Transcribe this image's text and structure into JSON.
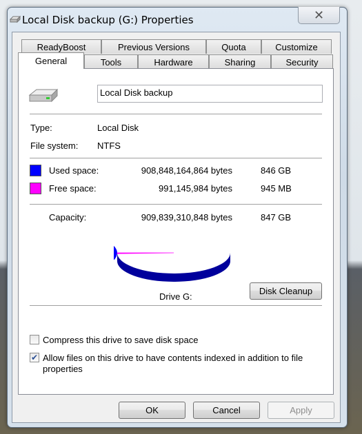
{
  "window": {
    "title": "Local Disk backup  (G:) Properties",
    "icon": "drive-icon",
    "close_icon": "close-icon"
  },
  "tabs_row1": [
    {
      "label": "ReadyBoost"
    },
    {
      "label": "Previous Versions"
    },
    {
      "label": "Quota"
    },
    {
      "label": "Customize"
    }
  ],
  "tabs_row2": [
    {
      "label": "General",
      "selected": true
    },
    {
      "label": "Tools"
    },
    {
      "label": "Hardware"
    },
    {
      "label": "Sharing"
    },
    {
      "label": "Security"
    }
  ],
  "general": {
    "drive_name": "Local Disk backup",
    "type_label": "Type:",
    "type_value": "Local Disk",
    "fs_label": "File system:",
    "fs_value": "NTFS",
    "used_label": "Used space:",
    "used_bytes": "908,848,164,864 bytes",
    "used_size": "846 GB",
    "free_label": "Free space:",
    "free_bytes": "991,145,984 bytes",
    "free_size": "945 MB",
    "capacity_label": "Capacity:",
    "capacity_bytes": "909,839,310,848 bytes",
    "capacity_size": "847 GB",
    "drive_label": "Drive G:",
    "disk_cleanup": "Disk Cleanup",
    "compress_label": "Compress this drive to save disk space",
    "compress_checked": false,
    "index_label_1": "Allow files on this drive to have contents indexed in addition to file",
    "index_label_2": "properties",
    "index_checked": true
  },
  "colors": {
    "used": "#0000ff",
    "used_side": "#00009c",
    "free": "#ff00ff"
  },
  "chart_data": {
    "type": "pie",
    "values": [
      908848164864,
      991145984
    ],
    "categories": [
      "Used space",
      "Free space"
    ]
  },
  "buttons": {
    "ok": "OK",
    "cancel": "Cancel",
    "apply": "Apply",
    "apply_enabled": false
  }
}
